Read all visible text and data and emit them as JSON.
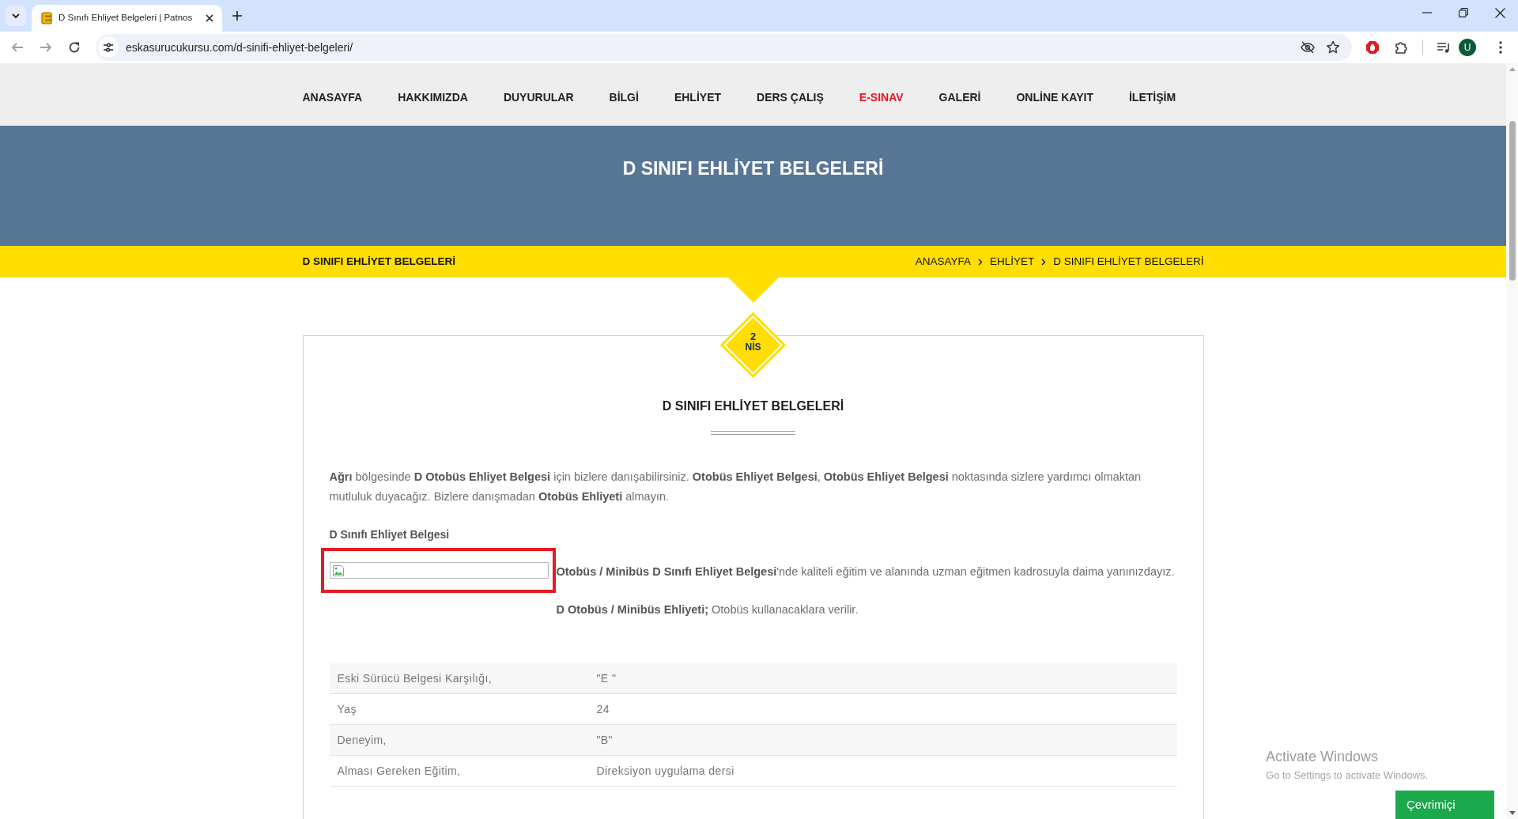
{
  "browser": {
    "tabs": [
      {
        "title": "D Sınıfı Ehliyet Belgeleri | Patnos",
        "selected": true
      }
    ],
    "url": "eskasurucukursu.com/d-sinifi-ehliyet-belgeleri/",
    "profile_initial": "U"
  },
  "nav": {
    "items": [
      {
        "label": "ANASAYFA",
        "highlighted": false
      },
      {
        "label": "HAKKIMIZDA",
        "highlighted": false
      },
      {
        "label": "DUYURULAR",
        "highlighted": false
      },
      {
        "label": "BİLGİ",
        "highlighted": false
      },
      {
        "label": "EHLİYET",
        "highlighted": false
      },
      {
        "label": "DERS ÇALIŞ",
        "highlighted": false
      },
      {
        "label": "E-SINAV",
        "highlighted": true
      },
      {
        "label": "GALERİ",
        "highlighted": false
      },
      {
        "label": "ONLİNE KAYIT",
        "highlighted": false
      },
      {
        "label": "İLETİŞİM",
        "highlighted": false
      }
    ]
  },
  "hero": {
    "title": "D SINIFI EHLİYET BELGELERİ"
  },
  "breadcrumb_bar": {
    "title": "D SINIFI EHLİYET BELGELERİ",
    "crumbs": [
      "ANASAYFA",
      "EHLİYET",
      "D SINIFI EHLİYET BELGELERİ"
    ]
  },
  "post": {
    "date": {
      "day": "2",
      "month": "NİS"
    },
    "title": "D SINIFI EHLİYET BELGELERİ",
    "intro": "**Ağrı** bölgesinde **D Otobüs Ehliyet Belgesi** için bizlere danışabilirsiniz. **Otobüs Ehliyet Belgesi**, **Otobüs Ehliyet Belgesi** noktasında sizlere yardımcı olmaktan mutluluk duyacağız. Bizlere danışmadan **Otobüs Ehliyeti** almayın.",
    "subheading": "D Sınıfı Ehliyet Belgesi",
    "image_caption": "**Otobüs / Minibüs D Sınıfı Ehliyet Belgesi**'nde kaliteli eğitim ve alanında uzman eğitmen kadrosuyla daima yanınızdayız.",
    "note": "**D Otobüs / Minibüs Ehliyeti;** Otobüs kullanacaklara verilir.",
    "table": {
      "rows": [
        [
          "Eski Sürücü Belgesi Karşılığı,",
          "\"E \""
        ],
        [
          "Yaş",
          "24"
        ],
        [
          "Deneyim,",
          "\"B\""
        ],
        [
          "Alması Gereken Eğitim,",
          "Direksiyon uygulama dersi"
        ]
      ]
    }
  },
  "chat_button": {
    "label": "Çevrimiçi"
  },
  "os_notice": {
    "title": "Activate Windows",
    "subtitle": "Go to Settings to activate Windows."
  }
}
